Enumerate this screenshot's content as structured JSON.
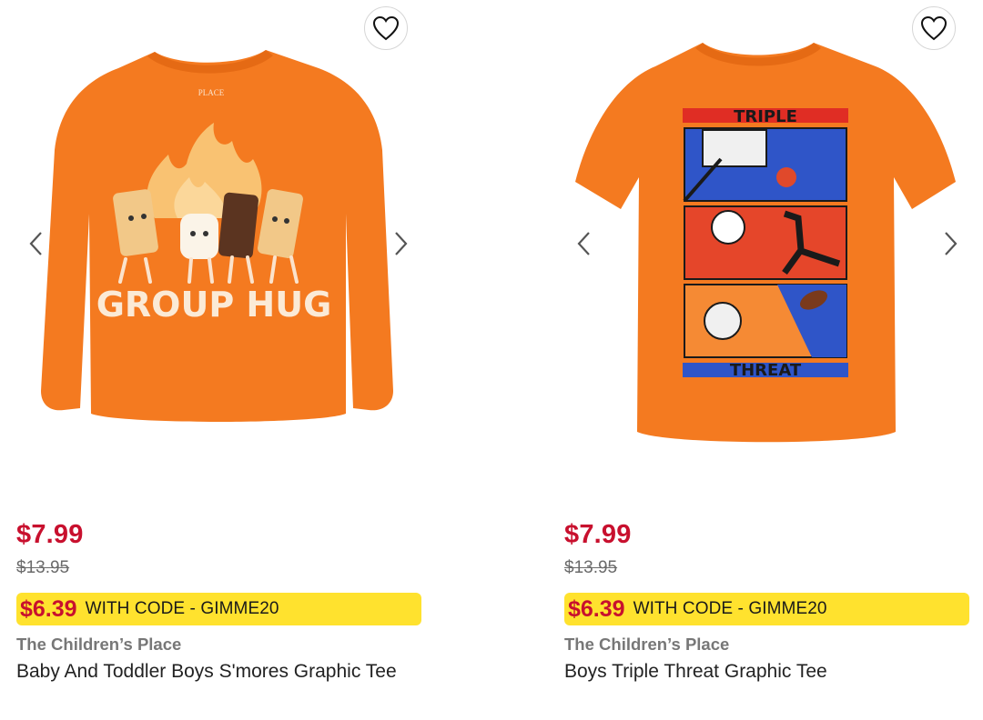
{
  "products": [
    {
      "image_alt": "Orange long sleeve tee with s'mores characters",
      "graphic_text": "GROUP HUG",
      "tag_text": "PLACE",
      "price": "$7.99",
      "was_price": "$13.95",
      "promo_price": "$6.39",
      "promo_text": "WITH CODE - GIMME20",
      "brand": "The Children’s Place",
      "name": "Baby And Toddler Boys S'mores Graphic Tee"
    },
    {
      "image_alt": "Orange short sleeve tee with sports panels",
      "graphic_text_top": "TRIPLE",
      "graphic_text_bottom": "THREAT",
      "price": "$7.99",
      "was_price": "$13.95",
      "promo_price": "$6.39",
      "promo_text": "WITH CODE - GIMME20",
      "brand": "The Children’s Place",
      "name": "Boys Triple Threat Graphic Tee"
    }
  ],
  "icons": {
    "favorite": "heart-outline-icon",
    "prev": "chevron-left-icon",
    "next": "chevron-right-icon"
  },
  "colors": {
    "price": "#c8102e",
    "promo_bg": "#ffe22e",
    "shirt": "#f47a20"
  }
}
